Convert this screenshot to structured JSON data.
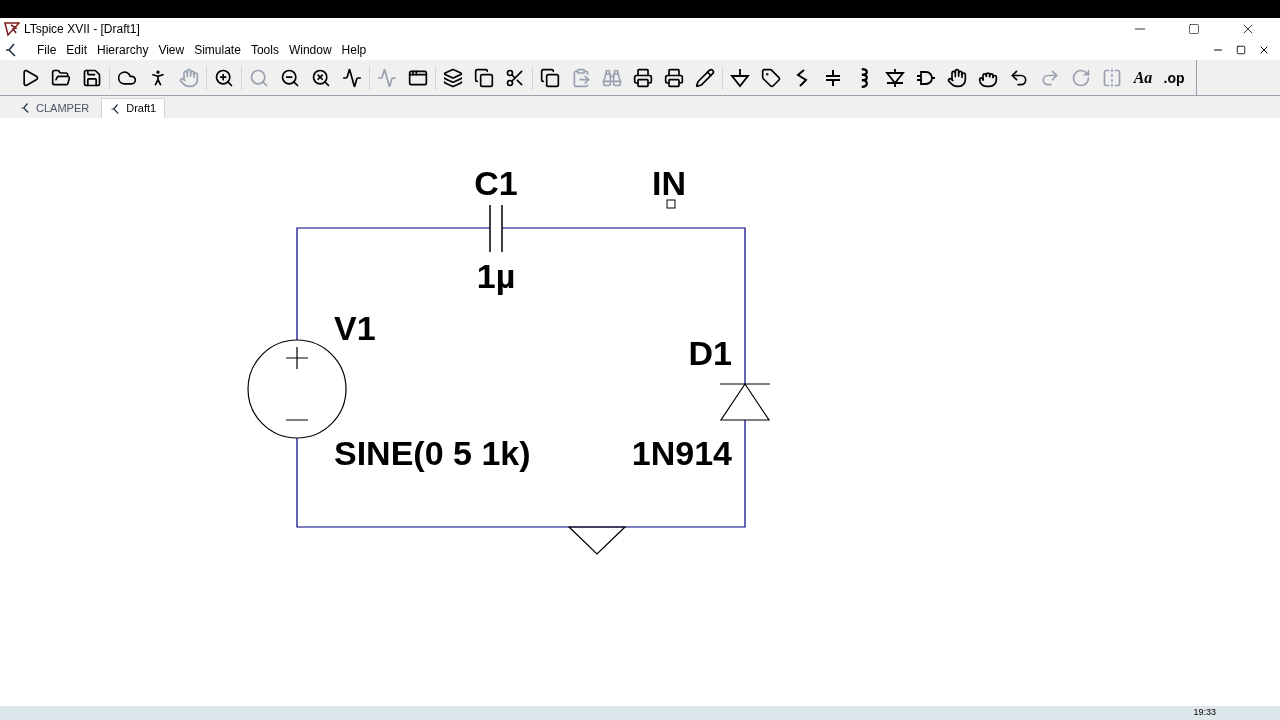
{
  "window": {
    "title": "LTspice XVII - [Draft1]"
  },
  "menu": [
    {
      "label": "File"
    },
    {
      "label": "Edit"
    },
    {
      "label": "Hierarchy"
    },
    {
      "label": "View"
    },
    {
      "label": "Simulate"
    },
    {
      "label": "Tools"
    },
    {
      "label": "Window"
    },
    {
      "label": "Help"
    }
  ],
  "toolbar": [
    {
      "kind": "run",
      "disabled": false
    },
    {
      "kind": "open",
      "disabled": false
    },
    {
      "kind": "save",
      "disabled": false
    },
    {
      "kind": "control",
      "disabled": false
    },
    {
      "kind": "halt",
      "disabled": false
    },
    {
      "kind": "probe",
      "disabled": true
    },
    {
      "kind": "zoom_in",
      "disabled": false
    },
    {
      "kind": "zoom_pan",
      "disabled": true
    },
    {
      "kind": "zoom_out",
      "disabled": false
    },
    {
      "kind": "zoom_cancel",
      "disabled": false
    },
    {
      "kind": "wave",
      "disabled": false
    },
    {
      "kind": "wave",
      "disabled": true
    },
    {
      "kind": "tile",
      "disabled": false
    },
    {
      "kind": "cascade",
      "disabled": false
    },
    {
      "kind": "restore",
      "disabled": false
    },
    {
      "kind": "cut",
      "disabled": false
    },
    {
      "kind": "copy",
      "disabled": false
    },
    {
      "kind": "paste",
      "disabled": true
    },
    {
      "kind": "find",
      "disabled": true
    },
    {
      "kind": "print",
      "disabled": false
    },
    {
      "kind": "print_setup",
      "disabled": false
    },
    {
      "kind": "wire",
      "disabled": false
    },
    {
      "kind": "ground",
      "disabled": false
    },
    {
      "kind": "label",
      "disabled": false
    },
    {
      "kind": "resistor",
      "disabled": false
    },
    {
      "kind": "capacitor",
      "disabled": false
    },
    {
      "kind": "inductor",
      "disabled": false
    },
    {
      "kind": "diode",
      "disabled": false
    },
    {
      "kind": "component",
      "disabled": false
    },
    {
      "kind": "move",
      "disabled": false
    },
    {
      "kind": "drag",
      "disabled": false
    },
    {
      "kind": "undo",
      "disabled": false
    },
    {
      "kind": "redo",
      "disabled": true
    },
    {
      "kind": "rotate",
      "disabled": true
    },
    {
      "kind": "mirror",
      "disabled": true
    },
    {
      "kind": "text",
      "disabled": false,
      "label": "Aa"
    },
    {
      "kind": "spice",
      "disabled": false,
      "label": ".op"
    }
  ],
  "tabs": [
    {
      "label": "CLAMPER",
      "selected": false
    },
    {
      "label": "Draft1",
      "selected": true
    }
  ],
  "schematic": {
    "components": [
      {
        "kind": "capacitor",
        "name": "C1",
        "value": "1µ"
      },
      {
        "kind": "voltage_source",
        "name": "V1",
        "value": "SINE(0 5 1k)"
      },
      {
        "kind": "diode",
        "name": "D1",
        "value": "1N914"
      }
    ],
    "net_labels": [
      {
        "label": "IN"
      }
    ]
  },
  "taskbar": {
    "time": "19:33"
  }
}
